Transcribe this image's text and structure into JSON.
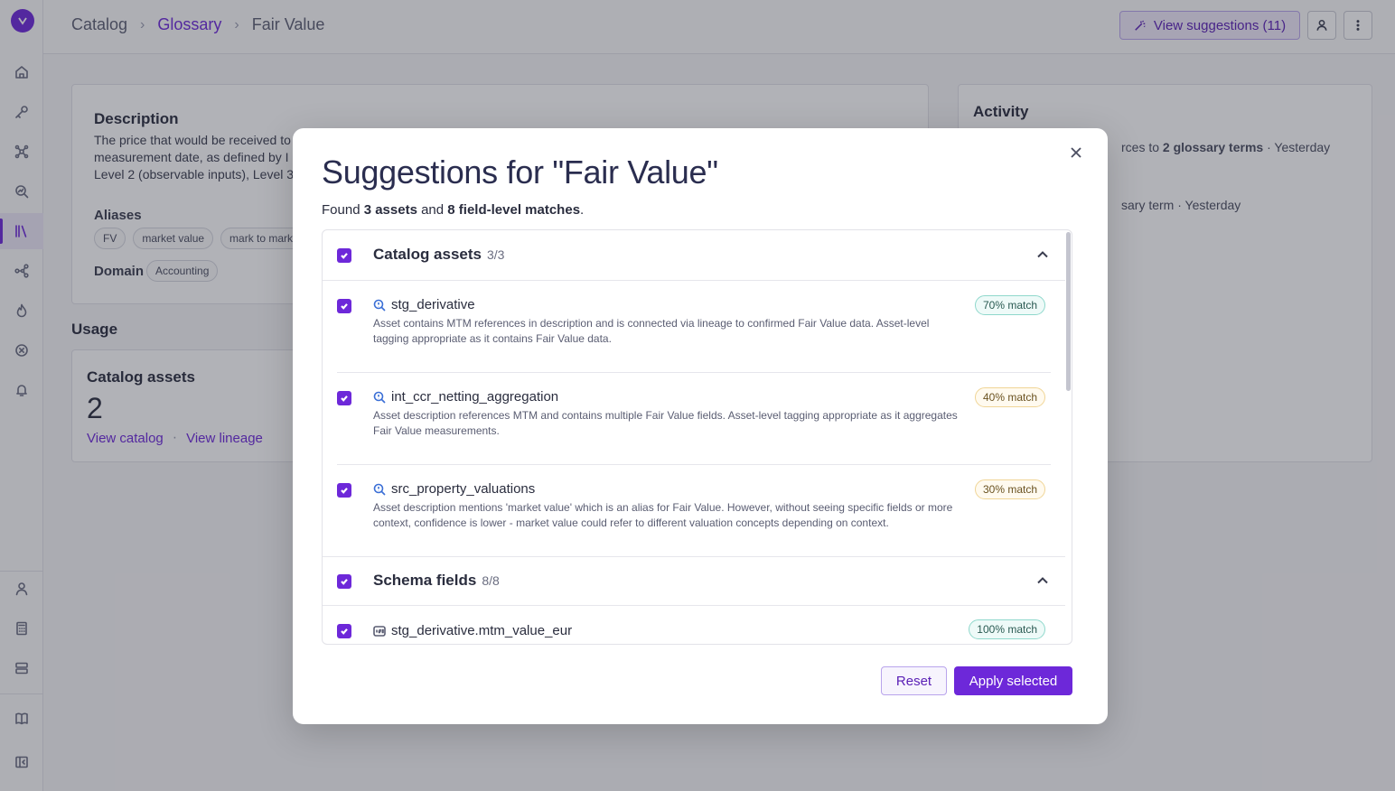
{
  "breadcrumb": {
    "catalog": "Catalog",
    "glossary": "Glossary",
    "current": "Fair Value"
  },
  "header": {
    "suggestions_button": "View suggestions (11)"
  },
  "term": {
    "description_heading": "Description",
    "description_lines": [
      "The price that would be received to",
      "measurement date, as defined by I",
      "Level 2 (observable inputs), Level 3"
    ],
    "aliases_label": "Aliases",
    "aliases": [
      "FV",
      "market value",
      "mark to marke"
    ],
    "domain_label": "Domain",
    "domain": "Accounting"
  },
  "usage": {
    "heading": "Usage",
    "card_title": "Catalog assets",
    "count": "2",
    "view_catalog": "View catalog",
    "separator": "·",
    "view_lineage": "View lineage"
  },
  "activity": {
    "heading": "Activity",
    "entry1_prefix": "rces to ",
    "entry1_bold": "2 glossary terms",
    "entry1_suffix": " · Yesterday",
    "entry2": "sary term · Yesterday"
  },
  "modal": {
    "title": "Suggestions for \"Fair Value\"",
    "summary_prefix": "Found ",
    "summary_assets": "3 assets",
    "summary_and": " and ",
    "summary_fields": "8 field-level matches",
    "summary_end": ".",
    "groups": [
      {
        "title": "Catalog assets",
        "count": "3/3",
        "items": [
          {
            "name": "stg_derivative",
            "match": "70% match",
            "description": "Asset contains MTM references in description and is connected via lineage to confirmed Fair Value data. Asset-level tagging appropriate as it contains Fair Value data."
          },
          {
            "name": "int_ccr_netting_aggregation",
            "match": "40% match",
            "description": "Asset description references MTM and contains multiple Fair Value fields. Asset-level tagging appropriate as it aggregates Fair Value measurements."
          },
          {
            "name": "src_property_valuations",
            "match": "30% match",
            "description": "Asset description mentions 'market value' which is an alias for Fair Value. However, without seeing specific fields or more context, confidence is lower - market value could refer to different valuation concepts depending on context."
          }
        ]
      },
      {
        "title": "Schema fields",
        "count": "8/8",
        "items": [
          {
            "name": "stg_derivative.mtm_value_eur",
            "match": "100% match"
          }
        ]
      }
    ],
    "reset_label": "Reset",
    "apply_label": "Apply selected"
  },
  "colors": {
    "accent": "#6d28d9",
    "badge_high_border": "#8fd8cc",
    "badge_medium_border": "#f0d596"
  },
  "icons": {
    "sidebar": [
      "home-icon",
      "key-icon",
      "graph-icon",
      "search-chart-icon",
      "library-icon",
      "lineage-icon",
      "fire-icon",
      "x-circle-icon",
      "bell-icon",
      "user-icon",
      "calculator-icon",
      "server-icon",
      "book-icon",
      "collapse-sidebar-icon"
    ]
  }
}
